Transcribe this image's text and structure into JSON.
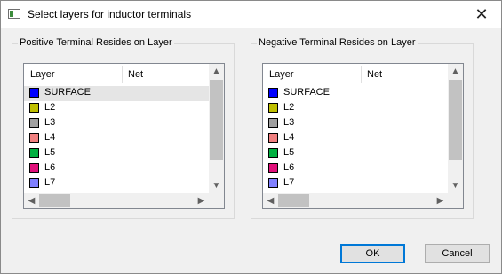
{
  "window": {
    "title": "Select layers for inductor terminals",
    "close_glyph": "✕"
  },
  "columns": {
    "layer": "Layer",
    "net": "Net"
  },
  "positive": {
    "label": "Positive Terminal Resides on Layer",
    "layers": [
      {
        "name": "SURFACE",
        "color": "#0000ff",
        "selected": true
      },
      {
        "name": "L2",
        "color": "#bfbf00"
      },
      {
        "name": "L3",
        "color": "#a0a0a0"
      },
      {
        "name": "L4",
        "color": "#f08080"
      },
      {
        "name": "L5",
        "color": "#00b040"
      },
      {
        "name": "L6",
        "color": "#e0107a"
      },
      {
        "name": "L7",
        "color": "#8080ff"
      }
    ]
  },
  "negative": {
    "label": "Negative Terminal Resides on Layer",
    "layers": [
      {
        "name": "SURFACE",
        "color": "#0000ff"
      },
      {
        "name": "L2",
        "color": "#bfbf00"
      },
      {
        "name": "L3",
        "color": "#a0a0a0"
      },
      {
        "name": "L4",
        "color": "#f08080"
      },
      {
        "name": "L5",
        "color": "#00b040"
      },
      {
        "name": "L6",
        "color": "#e0107a"
      },
      {
        "name": "L7",
        "color": "#8080ff"
      }
    ]
  },
  "buttons": {
    "ok": "OK",
    "cancel": "Cancel"
  },
  "scroll_icons": {
    "up": "▲",
    "down": "▼",
    "left": "◀",
    "right": "▶"
  }
}
